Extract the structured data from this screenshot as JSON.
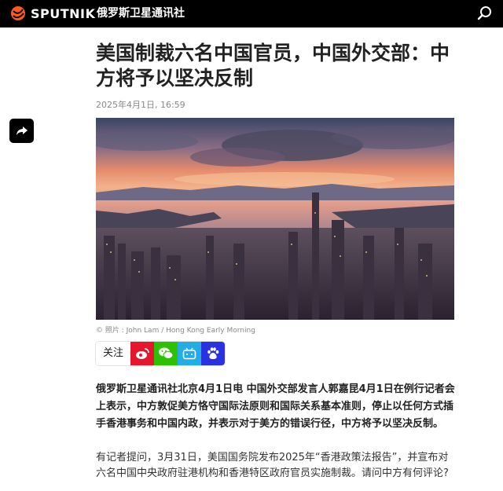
{
  "header": {
    "logo_text": "SPUTNIK",
    "site_name": "俄罗斯卫星通讯社",
    "search_icon": "search-icon"
  },
  "toolbar": {
    "share_icon": "share-icon"
  },
  "article": {
    "title": "美国制裁六名中国官员，中国外交部：中方将予以坚决反制",
    "datetime": "2025年4月1日, 16:59",
    "photo_caption": "© 照片 : John Lam / Hong Kong Early Morning",
    "lead": "俄罗斯卫星通讯社北京4月1日电 中国外交部发言人郭嘉昆4月1日在例行记者会上表示，中方敦促美方恪守国际法原则和国际关系基本准则，停止以任何方式插手香港事务和中国内政，并表示对于美方的错误行径，中方将予以坚决反制。",
    "paragraph_1": "有记者提问，3月31日，美国国务院发布2025年“香港政策法报告”，并宣布对六名中国中央政府驻港机构和香港特区政府官员实施制裁。请问中方有何评论?"
  },
  "social": {
    "follow_label": "关注",
    "buttons": [
      {
        "name": "weibo",
        "icon": "weibo-icon",
        "color": "#e6162d"
      },
      {
        "name": "wechat",
        "icon": "wechat-icon",
        "color": "#2dc100"
      },
      {
        "name": "bilibili",
        "icon": "bilibili-icon",
        "color": "#23ade5"
      },
      {
        "name": "baidu",
        "icon": "baidu-icon",
        "color": "#2932e1"
      }
    ]
  },
  "colors": {
    "header_bg": "#000000",
    "logo_accent": "#ff5a1f",
    "text": "#222222",
    "muted": "#888888"
  }
}
